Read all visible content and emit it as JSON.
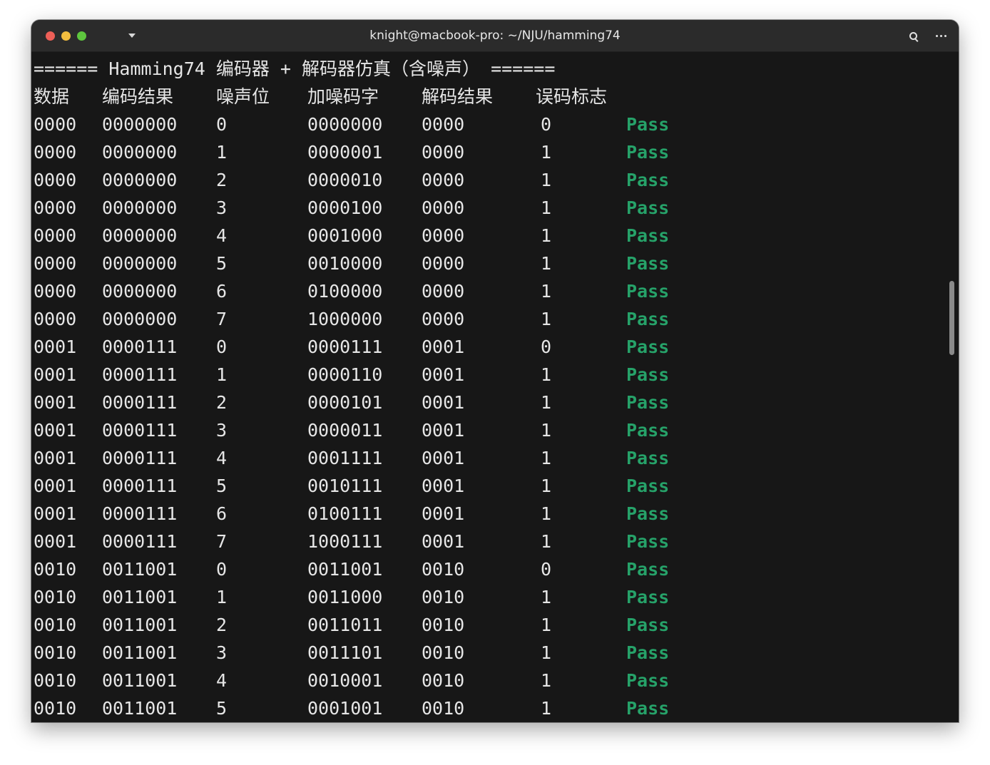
{
  "window": {
    "title": "knight@macbook-pro: ~/NJU/hamming74"
  },
  "terminal": {
    "banner": "====== Hamming74 编码器 + 解码器仿真（含噪声） ======",
    "headers": [
      "数据",
      "编码结果",
      "噪声位",
      "加噪码字",
      "解码结果",
      "误码标志"
    ],
    "rows": [
      [
        "0000",
        "0000000",
        "0",
        "0000000",
        "0000",
        "0",
        "Pass"
      ],
      [
        "0000",
        "0000000",
        "1",
        "0000001",
        "0000",
        "1",
        "Pass"
      ],
      [
        "0000",
        "0000000",
        "2",
        "0000010",
        "0000",
        "1",
        "Pass"
      ],
      [
        "0000",
        "0000000",
        "3",
        "0000100",
        "0000",
        "1",
        "Pass"
      ],
      [
        "0000",
        "0000000",
        "4",
        "0001000",
        "0000",
        "1",
        "Pass"
      ],
      [
        "0000",
        "0000000",
        "5",
        "0010000",
        "0000",
        "1",
        "Pass"
      ],
      [
        "0000",
        "0000000",
        "6",
        "0100000",
        "0000",
        "1",
        "Pass"
      ],
      [
        "0000",
        "0000000",
        "7",
        "1000000",
        "0000",
        "1",
        "Pass"
      ],
      [
        "0001",
        "0000111",
        "0",
        "0000111",
        "0001",
        "0",
        "Pass"
      ],
      [
        "0001",
        "0000111",
        "1",
        "0000110",
        "0001",
        "1",
        "Pass"
      ],
      [
        "0001",
        "0000111",
        "2",
        "0000101",
        "0001",
        "1",
        "Pass"
      ],
      [
        "0001",
        "0000111",
        "3",
        "0000011",
        "0001",
        "1",
        "Pass"
      ],
      [
        "0001",
        "0000111",
        "4",
        "0001111",
        "0001",
        "1",
        "Pass"
      ],
      [
        "0001",
        "0000111",
        "5",
        "0010111",
        "0001",
        "1",
        "Pass"
      ],
      [
        "0001",
        "0000111",
        "6",
        "0100111",
        "0001",
        "1",
        "Pass"
      ],
      [
        "0001",
        "0000111",
        "7",
        "1000111",
        "0001",
        "1",
        "Pass"
      ],
      [
        "0010",
        "0011001",
        "0",
        "0011001",
        "0010",
        "0",
        "Pass"
      ],
      [
        "0010",
        "0011001",
        "1",
        "0011000",
        "0010",
        "1",
        "Pass"
      ],
      [
        "0010",
        "0011001",
        "2",
        "0011011",
        "0010",
        "1",
        "Pass"
      ],
      [
        "0010",
        "0011001",
        "3",
        "0011101",
        "0010",
        "1",
        "Pass"
      ],
      [
        "0010",
        "0011001",
        "4",
        "0010001",
        "0010",
        "1",
        "Pass"
      ],
      [
        "0010",
        "0011001",
        "5",
        "0001001",
        "0010",
        "1",
        "Pass"
      ]
    ]
  },
  "colors": {
    "pass": "#26a269",
    "background": "#171717",
    "foreground": "#e6e6e6",
    "titlebar": "#2b2b2b"
  },
  "icons": [
    "close-light",
    "minimize-light",
    "maximize-light",
    "chevron-down-icon",
    "search-icon",
    "menu-dots-icon"
  ]
}
